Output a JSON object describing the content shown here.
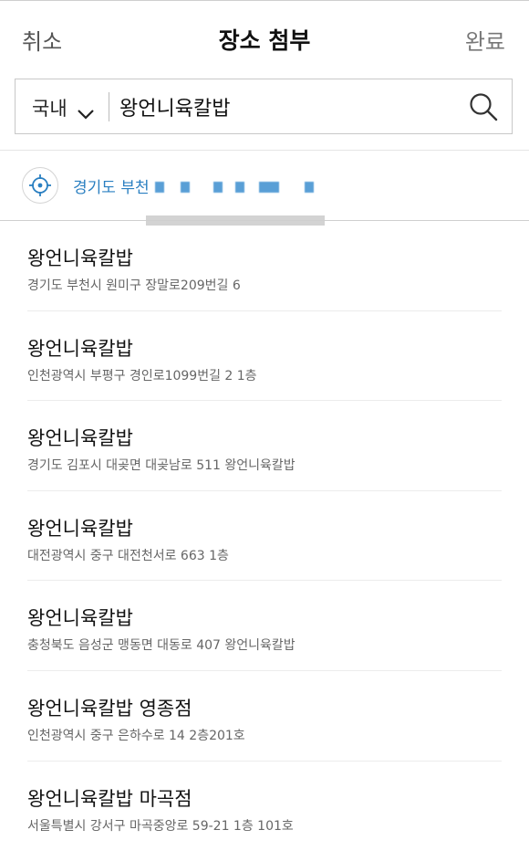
{
  "header": {
    "cancel": "취소",
    "title": "장소 첨부",
    "done": "완료"
  },
  "search": {
    "region": "국내",
    "query": "왕언니육칼밥",
    "search_icon": "magnifier"
  },
  "current_location": {
    "text": "경기도 부천",
    "icon": "crosshair"
  },
  "results": [
    {
      "name": "왕언니육칼밥",
      "address": "경기도 부천시 원미구 장말로209번길 6"
    },
    {
      "name": "왕언니육칼밥",
      "address": "인천광역시 부평구 경인로1099번길 2 1층"
    },
    {
      "name": "왕언니육칼밥",
      "address": "경기도 김포시 대곶면 대곶남로 511 왕언니육칼밥"
    },
    {
      "name": "왕언니육칼밥",
      "address": "대전광역시 중구 대전천서로 663 1층"
    },
    {
      "name": "왕언니육칼밥",
      "address": "충청북도 음성군 맹동면 대동로 407 왕언니육칼밥"
    },
    {
      "name": "왕언니육칼밥 영종점",
      "address": "인천광역시 중구 은하수로 14 2층201호"
    },
    {
      "name": "왕언니육칼밥 마곡점",
      "address": "서울특별시 강서구 마곡중앙로 59-21 1층 101호"
    }
  ],
  "colors": {
    "accent": "#2a7fc1"
  }
}
